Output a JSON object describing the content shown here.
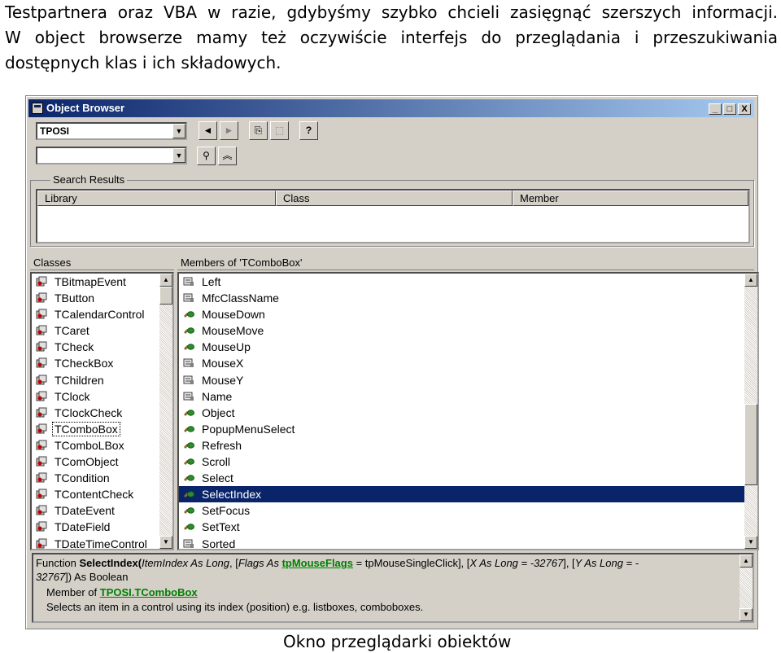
{
  "intro": {
    "line1": "Testpartnera oraz VBA w razie, gdybyśmy szybko chcieli zasięgnąć szerszych informacji.",
    "line2": "W object browserze mamy też oczywiście interfejs do przeglądania i przeszukiwania",
    "line3": "dostępnych klas i ich składowych."
  },
  "caption": "Okno przeglądarki obiektów",
  "window": {
    "title": "Object Browser",
    "minimize": "_",
    "maximize": "□",
    "close": "X"
  },
  "toolbar": {
    "library_value": "TPOSI",
    "search_value": "",
    "back": "◄",
    "forward": "►",
    "copy": "⎘",
    "view_def": "⬚",
    "help": "?",
    "search": "⚲",
    "toggle": "︽"
  },
  "search_results": {
    "label": "Search Results",
    "columns": [
      "Library",
      "Class",
      "Member"
    ]
  },
  "classes": {
    "label": "Classes",
    "items": [
      "TBitmapEvent",
      "TButton",
      "TCalendarControl",
      "TCaret",
      "TCheck",
      "TCheckBox",
      "TChildren",
      "TClock",
      "TClockCheck",
      "TComboBox",
      "TComboLBox",
      "TComObject",
      "TCondition",
      "TContentCheck",
      "TDateEvent",
      "TDateField",
      "TDateTimeControl"
    ],
    "focused": "TComboBox"
  },
  "members": {
    "label": "Members of 'TComboBox'",
    "items": [
      {
        "name": "Left",
        "kind": "property"
      },
      {
        "name": "MfcClassName",
        "kind": "property"
      },
      {
        "name": "MouseDown",
        "kind": "method"
      },
      {
        "name": "MouseMove",
        "kind": "method"
      },
      {
        "name": "MouseUp",
        "kind": "method"
      },
      {
        "name": "MouseX",
        "kind": "property"
      },
      {
        "name": "MouseY",
        "kind": "property"
      },
      {
        "name": "Name",
        "kind": "property"
      },
      {
        "name": "Object",
        "kind": "method"
      },
      {
        "name": "PopupMenuSelect",
        "kind": "method"
      },
      {
        "name": "Refresh",
        "kind": "method"
      },
      {
        "name": "Scroll",
        "kind": "method"
      },
      {
        "name": "Select",
        "kind": "method"
      },
      {
        "name": "SelectIndex",
        "kind": "method"
      },
      {
        "name": "SetFocus",
        "kind": "method"
      },
      {
        "name": "SetText",
        "kind": "method"
      },
      {
        "name": "Sorted",
        "kind": "property"
      }
    ],
    "selected": "SelectIndex"
  },
  "details": {
    "function_kw": "Function ",
    "function_name": "SelectIndex",
    "open_paren": "(",
    "param1": "ItemIndex As Long",
    "sep1": ", [",
    "param2_name": "Flags As ",
    "param2_type": "tpMouseFlags",
    "param2_default": " = tpMouseSingleClick], [",
    "param3": "X As Long = -32767",
    "sep3": "], [",
    "param4": "Y As Long = -",
    "line2a": "32767",
    "line2b": "]) As Boolean",
    "member_of": "Member of ",
    "member_lib": "TPOSI",
    "member_dot": ".",
    "member_class": "TComboBox",
    "description": "Selects an item in a control using its index (position) e.g. listboxes, comboboxes."
  },
  "colors": {
    "title_active": "#0a246a",
    "face": "#d4d0c8",
    "selection": "#0a246a",
    "link": "#008000"
  }
}
